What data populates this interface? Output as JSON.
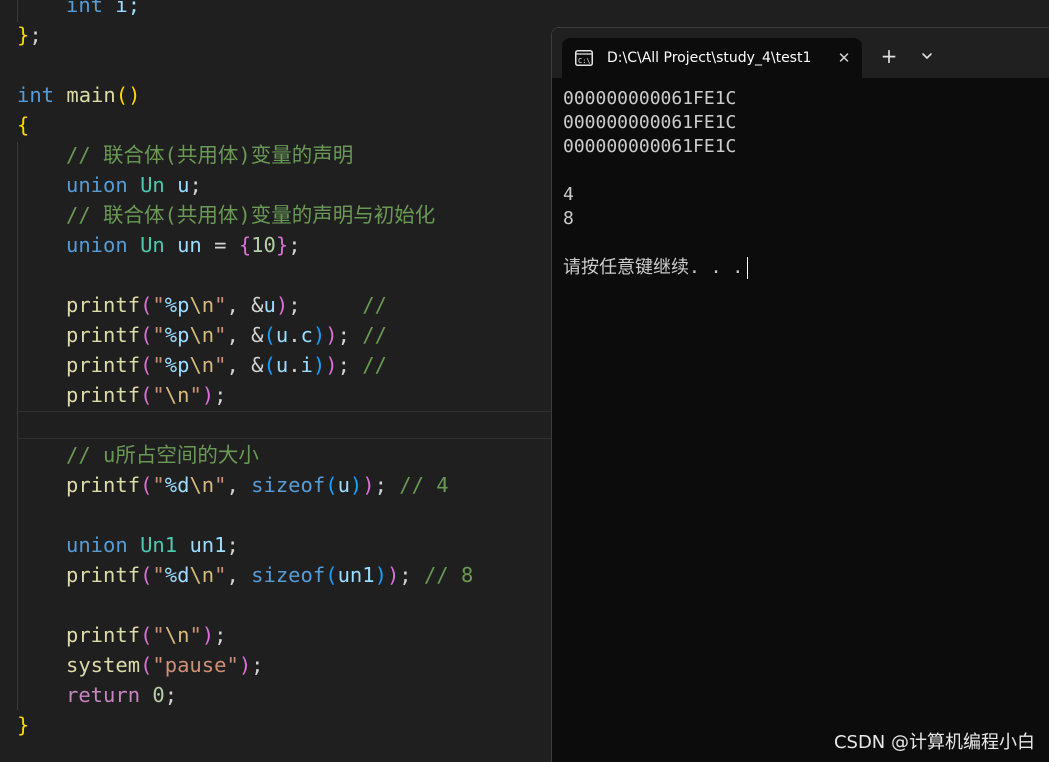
{
  "editor": {
    "lines": [
      {
        "indent": "    ",
        "tokens": [
          {
            "t": "int",
            "c": "kw"
          },
          {
            "t": " i;",
            "c": "va"
          }
        ]
      },
      {
        "indent": "",
        "tokens": [
          {
            "t": "}",
            "c": "b1"
          },
          {
            "t": ";",
            "c": "op"
          }
        ]
      },
      {
        "indent": "",
        "tokens": []
      },
      {
        "indent": "",
        "tokens": [
          {
            "t": "int",
            "c": "kw"
          },
          {
            "t": " ",
            "c": "op"
          },
          {
            "t": "main",
            "c": "fn"
          },
          {
            "t": "()",
            "c": "b1"
          }
        ]
      },
      {
        "indent": "",
        "tokens": [
          {
            "t": "{",
            "c": "b1"
          }
        ]
      },
      {
        "indent": "    ",
        "tokens": [
          {
            "t": "// 联合体(共用体)变量的声明",
            "c": "cm"
          }
        ]
      },
      {
        "indent": "    ",
        "tokens": [
          {
            "t": "union",
            "c": "kw"
          },
          {
            "t": " ",
            "c": "op"
          },
          {
            "t": "Un",
            "c": "ty"
          },
          {
            "t": " ",
            "c": "op"
          },
          {
            "t": "u",
            "c": "va"
          },
          {
            "t": ";",
            "c": "op"
          }
        ]
      },
      {
        "indent": "    ",
        "tokens": [
          {
            "t": "// 联合体(共用体)变量的声明与初始化",
            "c": "cm"
          }
        ]
      },
      {
        "indent": "    ",
        "tokens": [
          {
            "t": "union",
            "c": "kw"
          },
          {
            "t": " ",
            "c": "op"
          },
          {
            "t": "Un",
            "c": "ty"
          },
          {
            "t": " ",
            "c": "op"
          },
          {
            "t": "un",
            "c": "va"
          },
          {
            "t": " = ",
            "c": "op"
          },
          {
            "t": "{",
            "c": "b2"
          },
          {
            "t": "10",
            "c": "nu"
          },
          {
            "t": "}",
            "c": "b2"
          },
          {
            "t": ";",
            "c": "op"
          }
        ]
      },
      {
        "indent": "",
        "tokens": []
      },
      {
        "indent": "    ",
        "tokens": [
          {
            "t": "printf",
            "c": "fn"
          },
          {
            "t": "(",
            "c": "b2"
          },
          {
            "t": "\"",
            "c": "st"
          },
          {
            "t": "%p",
            "c": "fm"
          },
          {
            "t": "\\n",
            "c": "es"
          },
          {
            "t": "\"",
            "c": "st"
          },
          {
            "t": ", &",
            "c": "op"
          },
          {
            "t": "u",
            "c": "va"
          },
          {
            "t": ")",
            "c": "b2"
          },
          {
            "t": ";     ",
            "c": "op"
          },
          {
            "t": "//",
            "c": "cm"
          }
        ]
      },
      {
        "indent": "    ",
        "tokens": [
          {
            "t": "printf",
            "c": "fn"
          },
          {
            "t": "(",
            "c": "b2"
          },
          {
            "t": "\"",
            "c": "st"
          },
          {
            "t": "%p",
            "c": "fm"
          },
          {
            "t": "\\n",
            "c": "es"
          },
          {
            "t": "\"",
            "c": "st"
          },
          {
            "t": ", &",
            "c": "op"
          },
          {
            "t": "(",
            "c": "b3"
          },
          {
            "t": "u",
            "c": "va"
          },
          {
            "t": ".",
            "c": "op"
          },
          {
            "t": "c",
            "c": "va"
          },
          {
            "t": ")",
            "c": "b3"
          },
          {
            "t": ")",
            "c": "b2"
          },
          {
            "t": "; ",
            "c": "op"
          },
          {
            "t": "//",
            "c": "cm"
          }
        ]
      },
      {
        "indent": "    ",
        "tokens": [
          {
            "t": "printf",
            "c": "fn"
          },
          {
            "t": "(",
            "c": "b2"
          },
          {
            "t": "\"",
            "c": "st"
          },
          {
            "t": "%p",
            "c": "fm"
          },
          {
            "t": "\\n",
            "c": "es"
          },
          {
            "t": "\"",
            "c": "st"
          },
          {
            "t": ", &",
            "c": "op"
          },
          {
            "t": "(",
            "c": "b3"
          },
          {
            "t": "u",
            "c": "va"
          },
          {
            "t": ".",
            "c": "op"
          },
          {
            "t": "i",
            "c": "va"
          },
          {
            "t": ")",
            "c": "b3"
          },
          {
            "t": ")",
            "c": "b2"
          },
          {
            "t": "; ",
            "c": "op"
          },
          {
            "t": "//",
            "c": "cm"
          }
        ]
      },
      {
        "indent": "    ",
        "tokens": [
          {
            "t": "printf",
            "c": "fn"
          },
          {
            "t": "(",
            "c": "b2"
          },
          {
            "t": "\"",
            "c": "st"
          },
          {
            "t": "\\n",
            "c": "es"
          },
          {
            "t": "\"",
            "c": "st"
          },
          {
            "t": ")",
            "c": "b2"
          },
          {
            "t": ";",
            "c": "op"
          }
        ]
      },
      {
        "indent": "",
        "tokens": []
      },
      {
        "indent": "    ",
        "tokens": [
          {
            "t": "// u所占空间的大小",
            "c": "cm"
          }
        ]
      },
      {
        "indent": "    ",
        "tokens": [
          {
            "t": "printf",
            "c": "fn"
          },
          {
            "t": "(",
            "c": "b2"
          },
          {
            "t": "\"",
            "c": "st"
          },
          {
            "t": "%d",
            "c": "fm"
          },
          {
            "t": "\\n",
            "c": "es"
          },
          {
            "t": "\"",
            "c": "st"
          },
          {
            "t": ", ",
            "c": "op"
          },
          {
            "t": "sizeof",
            "c": "kw"
          },
          {
            "t": "(",
            "c": "b3"
          },
          {
            "t": "u",
            "c": "va"
          },
          {
            "t": ")",
            "c": "b3"
          },
          {
            "t": ")",
            "c": "b2"
          },
          {
            "t": "; ",
            "c": "op"
          },
          {
            "t": "// 4",
            "c": "cm"
          }
        ]
      },
      {
        "indent": "",
        "tokens": []
      },
      {
        "indent": "    ",
        "tokens": [
          {
            "t": "union",
            "c": "kw"
          },
          {
            "t": " ",
            "c": "op"
          },
          {
            "t": "Un1",
            "c": "ty"
          },
          {
            "t": " ",
            "c": "op"
          },
          {
            "t": "un1",
            "c": "va"
          },
          {
            "t": ";",
            "c": "op"
          }
        ]
      },
      {
        "indent": "    ",
        "tokens": [
          {
            "t": "printf",
            "c": "fn"
          },
          {
            "t": "(",
            "c": "b2"
          },
          {
            "t": "\"",
            "c": "st"
          },
          {
            "t": "%d",
            "c": "fm"
          },
          {
            "t": "\\n",
            "c": "es"
          },
          {
            "t": "\"",
            "c": "st"
          },
          {
            "t": ", ",
            "c": "op"
          },
          {
            "t": "sizeof",
            "c": "kw"
          },
          {
            "t": "(",
            "c": "b3"
          },
          {
            "t": "un1",
            "c": "va"
          },
          {
            "t": ")",
            "c": "b3"
          },
          {
            "t": ")",
            "c": "b2"
          },
          {
            "t": "; ",
            "c": "op"
          },
          {
            "t": "// 8",
            "c": "cm"
          }
        ]
      },
      {
        "indent": "",
        "tokens": []
      },
      {
        "indent": "    ",
        "tokens": [
          {
            "t": "printf",
            "c": "fn"
          },
          {
            "t": "(",
            "c": "b2"
          },
          {
            "t": "\"",
            "c": "st"
          },
          {
            "t": "\\n",
            "c": "es"
          },
          {
            "t": "\"",
            "c": "st"
          },
          {
            "t": ")",
            "c": "b2"
          },
          {
            "t": ";",
            "c": "op"
          }
        ]
      },
      {
        "indent": "    ",
        "tokens": [
          {
            "t": "system",
            "c": "fn"
          },
          {
            "t": "(",
            "c": "b2"
          },
          {
            "t": "\"pause\"",
            "c": "st"
          },
          {
            "t": ")",
            "c": "b2"
          },
          {
            "t": ";",
            "c": "op"
          }
        ]
      },
      {
        "indent": "    ",
        "tokens": [
          {
            "t": "return",
            "c": "ctl"
          },
          {
            "t": " ",
            "c": "op"
          },
          {
            "t": "0",
            "c": "nu"
          },
          {
            "t": ";",
            "c": "op"
          }
        ]
      },
      {
        "indent": "",
        "tokens": [
          {
            "t": "}",
            "c": "b1"
          }
        ]
      }
    ]
  },
  "terminal": {
    "tab_title": "D:\\C\\All Project\\study_4\\test1",
    "tab_icon": "terminal-icon",
    "close_glyph": "✕",
    "new_tab_glyph": "+",
    "dropdown_icon": "chevron-down-icon",
    "output": [
      "000000000061FE1C",
      "000000000061FE1C",
      "000000000061FE1C",
      "",
      "4",
      "8",
      "",
      "请按任意键继续. . ."
    ]
  },
  "watermark": "CSDN @计算机编程小白"
}
